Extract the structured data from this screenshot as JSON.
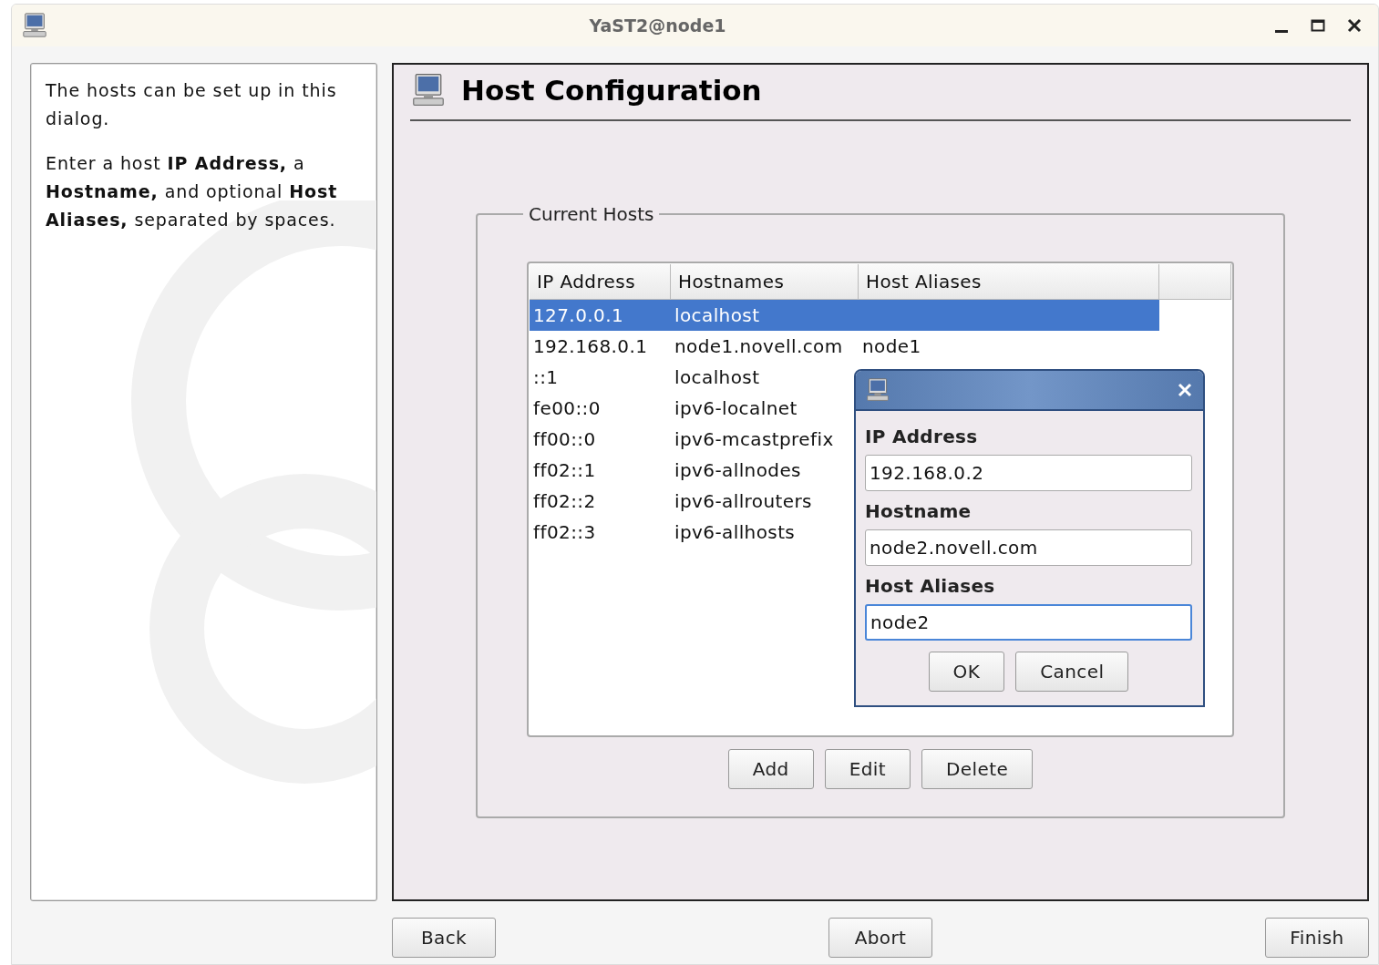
{
  "window": {
    "title": "YaST2@node1"
  },
  "help": {
    "paragraphs": [
      "The hosts can be set up in this dialog.",
      "Enter a host **IP Address,** a **Hostname,** and optional **Host Aliases,** separated by spaces."
    ]
  },
  "header": {
    "title": "Host Configuration"
  },
  "hosts_frame": {
    "legend": "Current Hosts",
    "table": {
      "columns": [
        "IP Address",
        "Hostnames",
        "Host Aliases"
      ],
      "rows": [
        {
          "ip": "127.0.0.1",
          "hostname": "localhost",
          "selected": true
        },
        {
          "ip": "192.168.0.1",
          "hostname": "node1.novell.com",
          "aliases": "node1",
          "selected": false
        },
        {
          "ip": "::1",
          "hostname": "localhost",
          "selected": false
        },
        {
          "ip": "fe00::0",
          "hostname": "ipv6-localnet",
          "selected": false
        },
        {
          "ip": "ff00::0",
          "hostname": "ipv6-mcastprefix",
          "selected": false
        },
        {
          "ip": "ff02::1",
          "hostname": "ipv6-allnodes",
          "selected": false
        },
        {
          "ip": "ff02::2",
          "hostname": "ipv6-allrouters",
          "selected": false
        },
        {
          "ip": "ff02::3",
          "hostname": "ipv6-allhosts",
          "selected": false
        }
      ]
    },
    "buttons": [
      "Add",
      "Edit",
      "Delete"
    ]
  },
  "edit_dialog": {
    "fields": [
      {
        "label": "IP Address",
        "value": "192.168.0.2",
        "focused": false
      },
      {
        "label": "Hostname",
        "value": "node2.novell.com",
        "focused": false
      },
      {
        "label": "Host Aliases",
        "value": "node2",
        "focused": true
      }
    ],
    "buttons": [
      "OK",
      "Cancel"
    ]
  },
  "footer": {
    "buttons": [
      "Back",
      "Abort",
      "Finish"
    ]
  }
}
